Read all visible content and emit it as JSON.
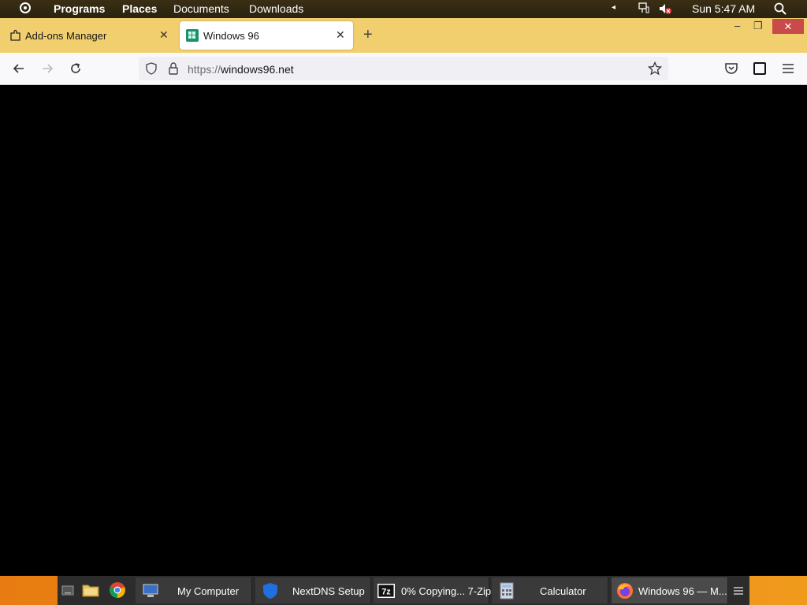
{
  "top_panel": {
    "menus": [
      "Programs",
      "Places",
      "Documents",
      "Downloads"
    ],
    "clock": "Sun 5:47 AM",
    "tray_arrow": "◂"
  },
  "tabs": [
    {
      "label": "Add-ons Manager",
      "icon": "puzzle-icon",
      "close": "✕"
    },
    {
      "label": "Windows 96",
      "icon": "windows96-icon",
      "close": "✕",
      "active": true
    }
  ],
  "newtab": "+",
  "window_controls": {
    "minimize": "–",
    "restore": "❐",
    "close": "✕"
  },
  "navbar": {
    "url_scheme": "https://",
    "url_host": "windows96.net"
  },
  "taskbar": {
    "items": [
      {
        "label": "My Computer"
      },
      {
        "label": "NextDNS Setup"
      },
      {
        "label": "0% Copying... 7-Zip"
      },
      {
        "label": "Calculator"
      },
      {
        "label": "Windows 96 — M..."
      }
    ],
    "seven_zip_badge": "7z"
  },
  "colors": {
    "tabstrip": "#f2cf6e",
    "taskbar_accent": "#e98914",
    "close_red": "#c94a4a"
  }
}
